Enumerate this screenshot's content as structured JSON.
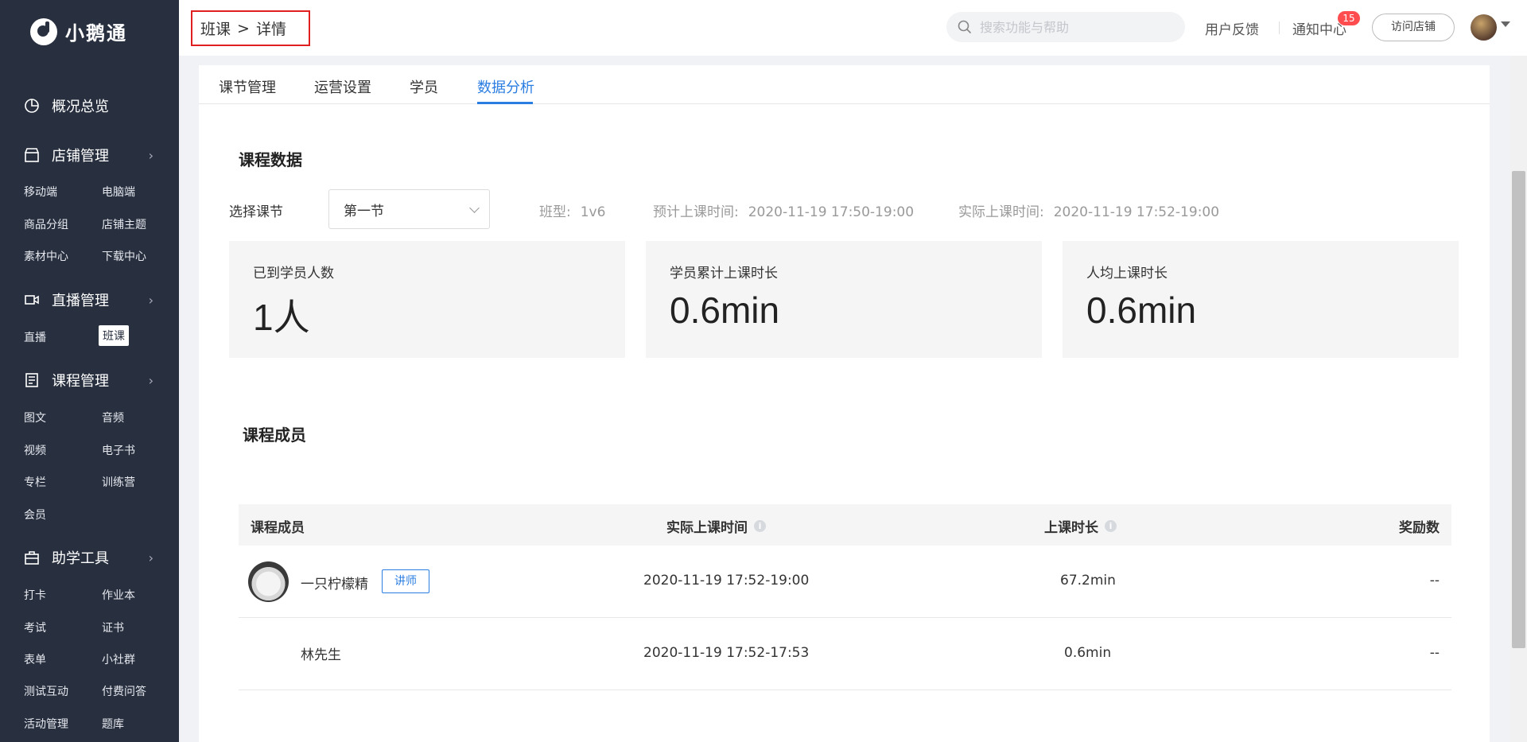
{
  "app": {
    "logo_text": "小鹅通"
  },
  "sidebar": {
    "overview": "概况总览",
    "store": {
      "label": "店铺管理",
      "items": [
        "移动端",
        "电脑端",
        "商品分组",
        "店铺主题",
        "素材中心",
        "下载中心"
      ]
    },
    "live": {
      "label": "直播管理",
      "items": [
        "直播",
        "班课"
      ],
      "active": "班课"
    },
    "course": {
      "label": "课程管理",
      "items": [
        "图文",
        "音频",
        "视频",
        "电子书",
        "专栏",
        "训练营",
        "会员"
      ]
    },
    "tools": {
      "label": "助学工具",
      "items": [
        "打卡",
        "作业本",
        "考试",
        "证书",
        "表单",
        "小社群",
        "测试互动",
        "付费问答",
        "活动管理",
        "题库"
      ]
    }
  },
  "header": {
    "breadcrumb": {
      "parent": "班课",
      "separator": ">",
      "current": "详情"
    },
    "search_placeholder": "搜索功能与帮助",
    "feedback": "用户反馈",
    "notice": "通知中心",
    "notice_count": "15",
    "visit_store": "访问店铺"
  },
  "tabs": [
    {
      "label": "课节管理"
    },
    {
      "label": "运营设置"
    },
    {
      "label": "学员"
    },
    {
      "label": "数据分析",
      "active": true
    }
  ],
  "course_data": {
    "title": "课程数据",
    "select_label": "选择课节",
    "selected_lesson": "第一节",
    "class_type_label": "班型:",
    "class_type": "1v6",
    "planned_time_label": "预计上课时间:",
    "planned_time": "2020-11-19 17:50-19:00",
    "actual_time_label": "实际上课时间:",
    "actual_time": "2020-11-19 17:52-19:00",
    "stats": [
      {
        "label": "已到学员人数",
        "value": "1人"
      },
      {
        "label": "学员累计上课时长",
        "value": "0.6min"
      },
      {
        "label": "人均上课时长",
        "value": "0.6min"
      }
    ]
  },
  "members": {
    "title": "课程成员",
    "columns": [
      "课程成员",
      "实际上课时间",
      "上课时长",
      "奖励数"
    ],
    "rows": [
      {
        "name": "一只柠檬精",
        "tag": "讲师",
        "time": "2020-11-19 17:52-19:00",
        "duration": "67.2min",
        "reward": "--"
      },
      {
        "name": "林先生",
        "tag": "",
        "time": "2020-11-19 17:52-17:53",
        "duration": "0.6min",
        "reward": "--"
      }
    ]
  }
}
